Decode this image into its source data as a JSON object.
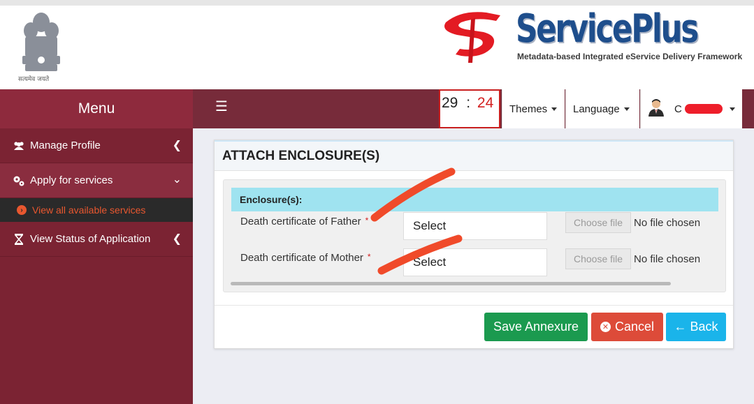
{
  "header": {
    "emblem_motto": "सत्यमेव जयते",
    "brand_name": "ServicePlus",
    "brand_tagline": "Metadata-based Integrated eService Delivery Framework"
  },
  "sidebar": {
    "title": "Menu",
    "items": [
      {
        "label": "Manage Profile",
        "icon": "users-icon",
        "chevron": "chevron-left-icon"
      },
      {
        "label": "Apply for services",
        "icon": "gears-icon",
        "chevron": "chevron-down-icon"
      },
      {
        "label": "View Status of Application",
        "icon": "hourglass-icon",
        "chevron": "chevron-left-icon"
      }
    ],
    "sub_items": [
      {
        "label": "View all available services",
        "icon": "arrow-circle-right-icon"
      }
    ]
  },
  "navbar": {
    "menu_icon": "hamburger-icon",
    "timer": {
      "minutes": "29",
      "separator": ":",
      "seconds": "24"
    },
    "themes_label": "Themes",
    "language_label": "Language",
    "user_initial": "C",
    "user_icon": "user-avatar-icon"
  },
  "form": {
    "title": "ATTACH ENCLOSURE(S)",
    "section_title": "Enclosure(s):",
    "rows": [
      {
        "label": "Death certificate of Father",
        "required_mark": "*",
        "select_value": "Select",
        "file_button": "Choose file",
        "file_status": "No file chosen"
      },
      {
        "label": "Death certificate of Mother",
        "required_mark": "*",
        "select_value": "Select",
        "file_button": "Choose file",
        "file_status": "No file chosen"
      }
    ],
    "buttons": {
      "save": "Save Annexure",
      "cancel": "Cancel",
      "back": "Back"
    }
  },
  "colors": {
    "sidebar": "#7b2333",
    "navbar": "#772b3a",
    "save": "#1b9a4f",
    "cancel": "#dd4b39",
    "back": "#1ab4ea",
    "section_header": "#9fe3f0",
    "annotation": "#f04a2a"
  }
}
